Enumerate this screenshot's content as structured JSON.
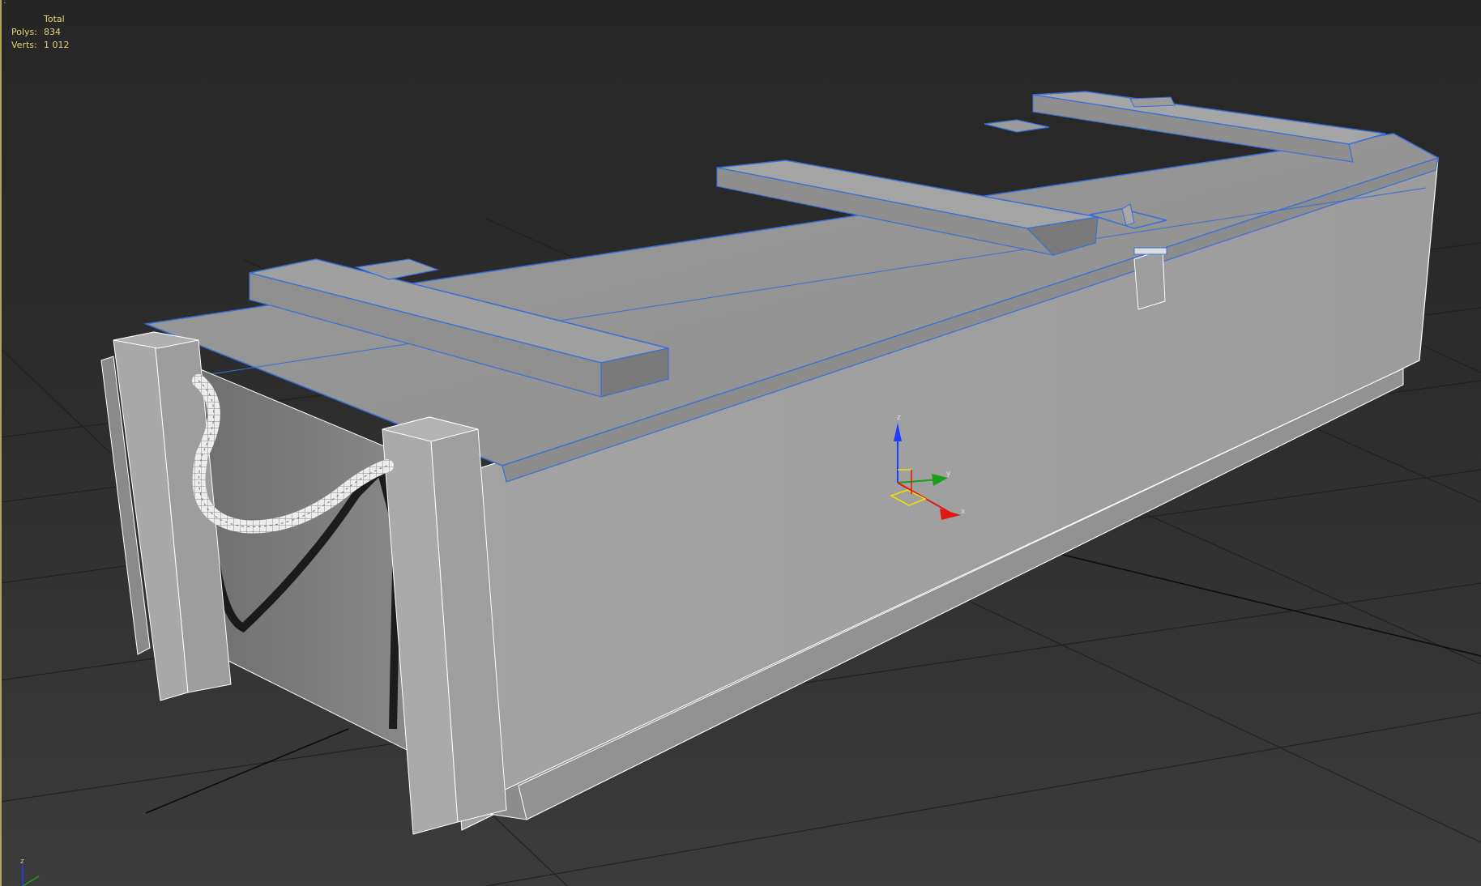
{
  "viewport": {
    "caption": ":",
    "stats": {
      "header": "Total",
      "polys_label": "Polys:",
      "polys_value": "834",
      "verts_label": "Verts:",
      "verts_value": "1 012"
    }
  },
  "gizmo": {
    "z_label": "z",
    "y_label": "y",
    "x_label": "x",
    "colors": {
      "z": "#1e3cff",
      "y": "#19a019",
      "x": "#e01818",
      "plane": "#f0e000"
    }
  },
  "view_cube_axes": {
    "z_label": "z"
  },
  "colors": {
    "selection_edge": "#3a6fd8",
    "wire_edge": "#ffffff",
    "grid_line": "#1f1f1f",
    "stats_text": "#e7d27a"
  }
}
